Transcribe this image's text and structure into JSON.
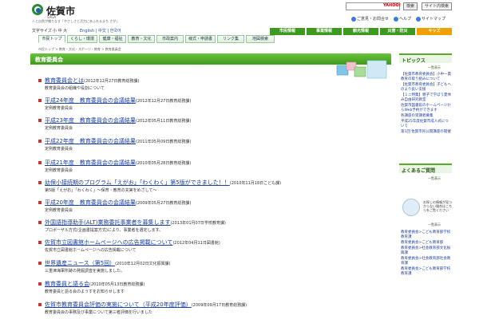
{
  "header": {
    "city_name": "佐賀市",
    "city_sub": "SAGA",
    "tagline": "人と自然が織りなす「やさしさと活力にあふれるまち さが」",
    "search_placeholder": "",
    "search_engine": "YAHOO!",
    "search_button": "検索",
    "search_option": "サイト内検索",
    "links": [
      "ご意見・お問合せ",
      "ヘルプ",
      "サイトマップ"
    ]
  },
  "util": {
    "font_size_label": "文字サイズ",
    "font_sizes": "小 中 大",
    "languages": "English | 中文 | 한국어",
    "sections": [
      "市民情報",
      "事業情報",
      "観光情報",
      "災害・防災",
      "キッズ"
    ],
    "section_colors": [
      "#3d9a1e",
      "#3d9a1e",
      "#3d9a1e",
      "#3d9a1e",
      "#f0a000"
    ]
  },
  "nav": {
    "items": [
      "市民トップ",
      "くらし・環境",
      "健康・福祉",
      "教育・文化",
      "市政案内",
      "様式・申請書",
      "リンク集",
      "地図検索"
    ]
  },
  "breadcrumb": "市民トップ > 教育・文化・スポーツ・教育 > 教育委員会",
  "page_title": "教育委員会",
  "items": [
    {
      "title": "教育委員会とは",
      "date": "(2012年12月27日教育総務課)",
      "desc": "教育委員会の組織や役割について"
    },
    {
      "title": "平成24年度　教育委員会の会議結果",
      "date": "(2012年12月27日教育総務課)",
      "desc": "定例教育委員会"
    },
    {
      "title": "平成23年度　教育委員会の会議結果",
      "date": "(2012年05月11日教育総務課)",
      "desc": "定例教育委員会"
    },
    {
      "title": "平成22年度　教育委員会の会議結果",
      "date": "(2011年05月09日教育総務課)",
      "desc": "定例教育委員会"
    },
    {
      "title": "平成21年度　教育委員会の会議結果",
      "date": "(2010年05月28日教育総務課)",
      "desc": "定例教育委員会"
    },
    {
      "title": "幼保小接続期のプログラム「えがお」「わくわく」第5版ができました！！",
      "date": "(2010年11月18日こども課)",
      "desc": "第5版「えがお」「わくわく」～保育・教育の充実をめざして～"
    },
    {
      "title": "平成20年度　教育委員会の会議結果",
      "date": "(2009年05月27日教育総務課)",
      "desc": "定例教育委員会"
    },
    {
      "title": "外国語指導助手(ALT)業務委託事業者を募集します",
      "date": "(2013年01月07日学校教育課)",
      "desc": "プロポーザル方式(企画書提案方式)により、事業者を選定します。"
    },
    {
      "title": "佐賀市立図書館ホームページへの広告掲載について",
      "date": "(2012年04月11日図書館)",
      "desc": "佐賀市立図書館ホームページへの広告掲載について"
    },
    {
      "title": "世界遺産ニュース（第5回）",
      "date": "(2010年12月02日文化振興課)",
      "desc": "三重津海軍所跡の発掘調査を実施しました。"
    },
    {
      "title": "教育委員と語る会",
      "date": "(2010年05月13日教育総務課)",
      "desc": "教育委員と語る会のようすをお知らせします"
    },
    {
      "title": "佐賀市教育委員会評価の実施について（平成20年度評価）",
      "date": "(2009年09月17日教育総務課)",
      "desc": "教育委員会の事務及び事業について第三者評価を行いました"
    }
  ],
  "sidebar": {
    "topics_title": "トピックス",
    "more": "一覧表示",
    "topics": [
      "【佐賀市教育委員会】小中一貫教育の取り組みについて",
      "【佐賀市教育委員会】子どもへのより良い支援",
      "【ミニ特集】親子で学ぼう夏休み自由研究教室",
      "佐賀市図書館のホームページからWeb予約ができます",
      "各講座の受講者募集",
      "平成25年度佐賀市成人式について",
      "第1回 佐賀市民公開講座の開催"
    ],
    "faq_title": "よくあるご質問",
    "mascot_text": "お探しの情報が見つからない場合はこちらをご覧ください",
    "related": [
      "教育委員会>こども教育部学校教育課",
      "教育委員会>こども教育部",
      "教育委員会>社会教育部文化振興課",
      "教育委員会>社会教育部社会教育課",
      "教育委員会>こども教育部学校教育課"
    ]
  }
}
